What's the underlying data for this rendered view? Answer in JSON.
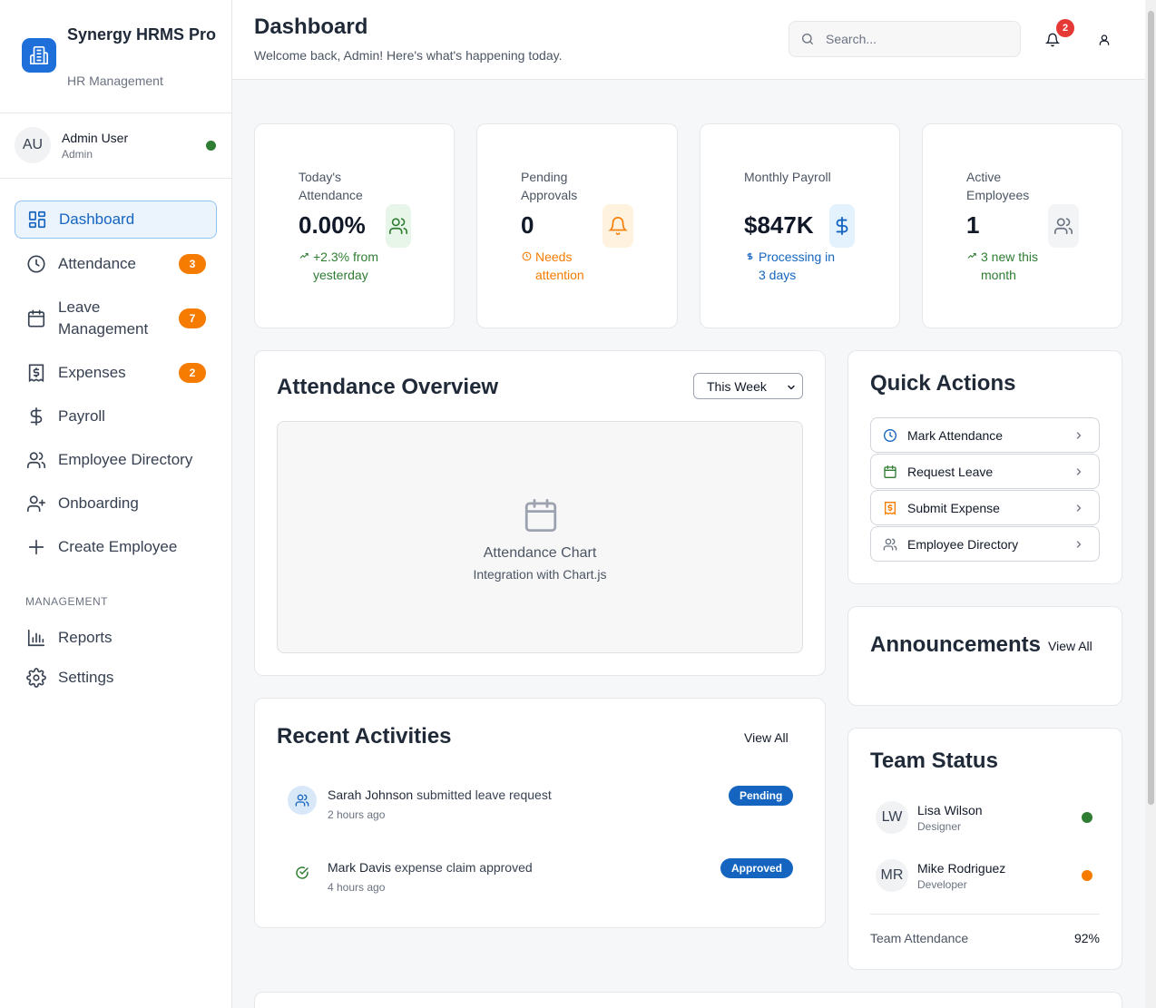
{
  "brand": {
    "name": "Synergy HRMS Pro",
    "subtitle": "HR Management"
  },
  "user": {
    "initials": "AU",
    "name": "Admin User",
    "role": "Admin",
    "status_color": "#2e7d32"
  },
  "nav": {
    "items": [
      {
        "label": "Dashboard",
        "icon": "dashboard-icon",
        "active": true
      },
      {
        "label": "Attendance",
        "icon": "clock-icon",
        "badge": "3"
      },
      {
        "label": "Leave Management",
        "icon": "calendar-icon",
        "badge": "7"
      },
      {
        "label": "Expenses",
        "icon": "receipt-icon",
        "badge": "2"
      },
      {
        "label": "Payroll",
        "icon": "dollar-icon"
      },
      {
        "label": "Employee Directory",
        "icon": "users-icon"
      },
      {
        "label": "Onboarding",
        "icon": "user-plus-icon"
      },
      {
        "label": "Create Employee",
        "icon": "plus-icon"
      }
    ],
    "section_label": "MANAGEMENT",
    "management_items": [
      {
        "label": "Reports",
        "icon": "bar-chart-icon"
      },
      {
        "label": "Settings",
        "icon": "gear-icon"
      }
    ]
  },
  "header": {
    "title": "Dashboard",
    "subtitle": "Welcome back, Admin! Here's what's happening today.",
    "search_placeholder": "Search...",
    "notification_count": "2"
  },
  "stats": [
    {
      "label": "Today's Attendance",
      "value": "0.00%",
      "trend": "+2.3% from yesterday",
      "trend_color": "#2e7d32",
      "icon": "users-icon",
      "icon_bg": "#e8f5e9"
    },
    {
      "label": "Pending Approvals",
      "value": "0",
      "trend": "Needs attention",
      "trend_color": "#f57c00",
      "icon": "bell-icon",
      "icon_bg": "#fff3e0"
    },
    {
      "label": "Monthly Payroll",
      "value": "$847K",
      "trend": "Processing in 3 days",
      "trend_color": "#1565c0",
      "icon": "dollar-icon",
      "icon_bg": "#e3f2fd"
    },
    {
      "label": "Active Employees",
      "value": "1",
      "trend": "3 new this month",
      "trend_color": "#2e7d32",
      "icon": "users-icon",
      "icon_bg": "#f3f4f6"
    }
  ],
  "attendance_overview": {
    "title": "Attendance Overview",
    "period_selected": "This Week",
    "chart_placeholder_title": "Attendance Chart",
    "chart_placeholder_sub": "Integration with Chart.js"
  },
  "quick_actions": {
    "title": "Quick Actions",
    "items": [
      {
        "label": "Mark Attendance",
        "icon": "clock-icon"
      },
      {
        "label": "Request Leave",
        "icon": "calendar-icon"
      },
      {
        "label": "Submit Expense",
        "icon": "receipt-icon"
      },
      {
        "label": "Employee Directory",
        "icon": "users-icon"
      }
    ]
  },
  "announcements": {
    "title": "Announcements",
    "view_all": "View All"
  },
  "recent_activities": {
    "title": "Recent Activities",
    "view_all": "View All",
    "items": [
      {
        "actor": "Sarah Johnson",
        "action": "submitted leave request",
        "time": "2 hours ago",
        "status": "Pending",
        "icon": "users-icon"
      },
      {
        "actor": "Mark Davis",
        "action": "expense claim approved",
        "time": "4 hours ago",
        "status": "Approved",
        "icon": "check-circle-icon"
      }
    ]
  },
  "team_status": {
    "title": "Team Status",
    "members": [
      {
        "initials": "LW",
        "name": "Lisa Wilson",
        "role": "Designer",
        "status_color": "#2e7d32"
      },
      {
        "initials": "MR",
        "name": "Mike Rodriguez",
        "role": "Developer",
        "status_color": "#f57c00"
      }
    ],
    "attendance_label": "Team Attendance",
    "attendance_value": "92%"
  }
}
